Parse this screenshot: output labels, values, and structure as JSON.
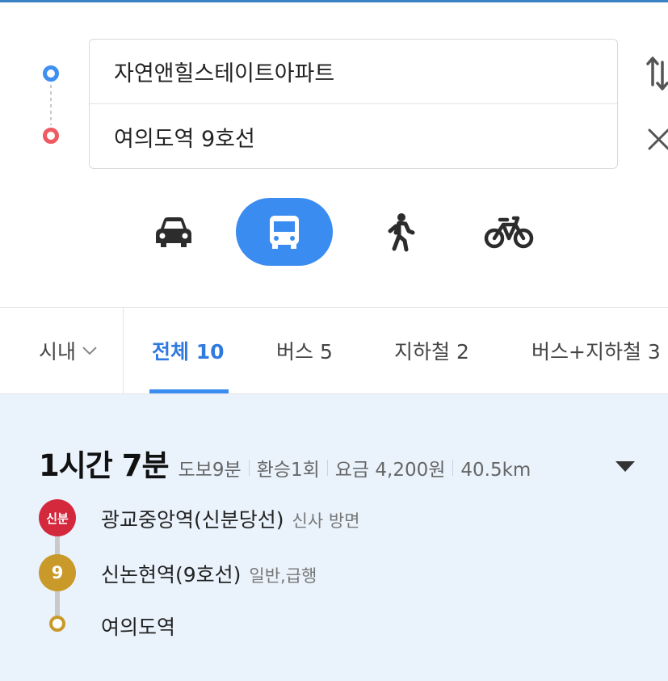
{
  "search": {
    "origin": "자연앤힐스테이트아파트",
    "destination": "여의도역 9호선"
  },
  "icons": {
    "swap": "swap-arrows-icon",
    "clear": "close-icon",
    "car": "car-icon",
    "bus": "bus-icon",
    "walk": "walk-icon",
    "bike": "bike-icon"
  },
  "colors": {
    "accent": "#3a8cf0",
    "origin_dot": "#3d8ff0",
    "destination_dot": "#ef5a62",
    "sinbundang_line": "#d4283d",
    "line9": "#c9992a",
    "result_bg": "#eaf3fc"
  },
  "filters": {
    "region": "시내",
    "tabs": [
      {
        "label": "전체 10",
        "active": true
      },
      {
        "label": "버스 5",
        "active": false
      },
      {
        "label": "지하철 2",
        "active": false
      },
      {
        "label": "버스+지하철 3",
        "active": false
      }
    ]
  },
  "result": {
    "duration": "1시간 7분",
    "walk": "도보9분",
    "transfer": "환승1회",
    "fare": "요금 4,200원",
    "distance": "40.5km",
    "steps": [
      {
        "badge": "신분",
        "name": "광교중앙역(신분당선)",
        "sub": "신사 방면"
      },
      {
        "badge": "9",
        "name": "신논현역(9호선)",
        "sub": "일반,급행"
      },
      {
        "badge": "",
        "name": "여의도역",
        "sub": ""
      }
    ]
  }
}
